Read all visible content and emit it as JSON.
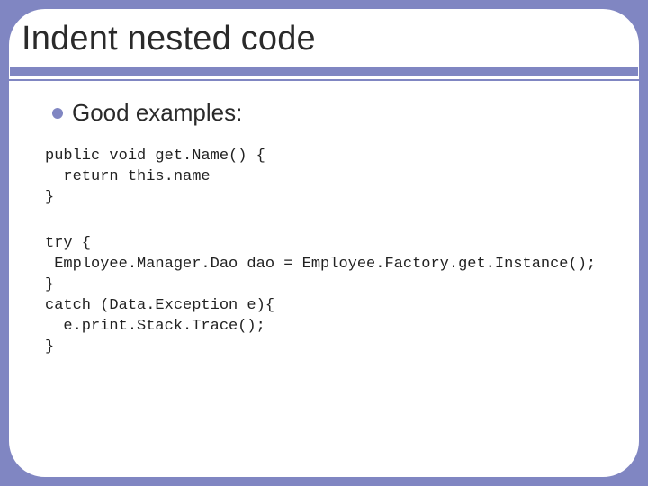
{
  "slide": {
    "title": "Indent nested code",
    "bullet": "Good examples:",
    "code1": "public void get.Name() {\n  return this.name\n}",
    "code2": "try {\n Employee.Manager.Dao dao = Employee.Factory.get.Instance();\n}\ncatch (Data.Exception e){\n  e.print.Stack.Trace();\n}"
  }
}
